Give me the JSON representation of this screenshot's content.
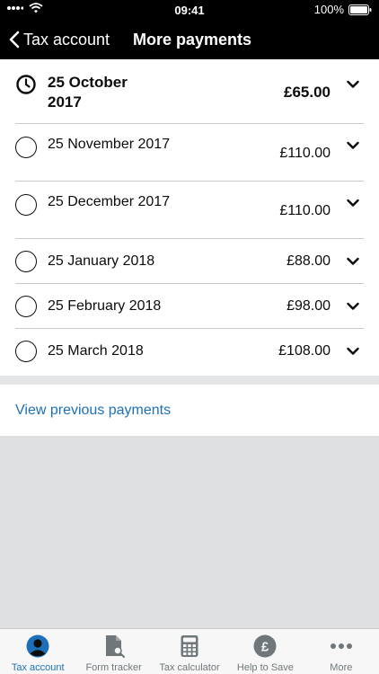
{
  "status_bar": {
    "time": "09:41",
    "battery": "100%"
  },
  "nav": {
    "back_label": "Tax account",
    "title": "More payments"
  },
  "payments": [
    {
      "date": "25 October 2017",
      "amount": "£65.00",
      "upcoming": true
    },
    {
      "date": "25 November 2017",
      "amount": "£110.00",
      "upcoming": false
    },
    {
      "date": "25 December 2017",
      "amount": "£110.00",
      "upcoming": false
    },
    {
      "date": "25 January 2018",
      "amount": "£88.00",
      "upcoming": false
    },
    {
      "date": "25 February 2018",
      "amount": "£98.00",
      "upcoming": false
    },
    {
      "date": "25 March 2018",
      "amount": "£108.00",
      "upcoming": false
    }
  ],
  "previous_link": "View previous payments",
  "tabbar": [
    {
      "label": "Tax account",
      "icon": "person-icon",
      "active": true
    },
    {
      "label": "Form tracker",
      "icon": "document-search-icon",
      "active": false
    },
    {
      "label": "Tax calculator",
      "icon": "calculator-icon",
      "active": false
    },
    {
      "label": "Help to Save",
      "icon": "pound-coin-icon",
      "active": false
    },
    {
      "label": "More",
      "icon": "more-dots-icon",
      "active": false
    }
  ],
  "colors": {
    "link": "#1d70b8",
    "active_tab": "#1d70b8",
    "header_bg": "#000000"
  }
}
